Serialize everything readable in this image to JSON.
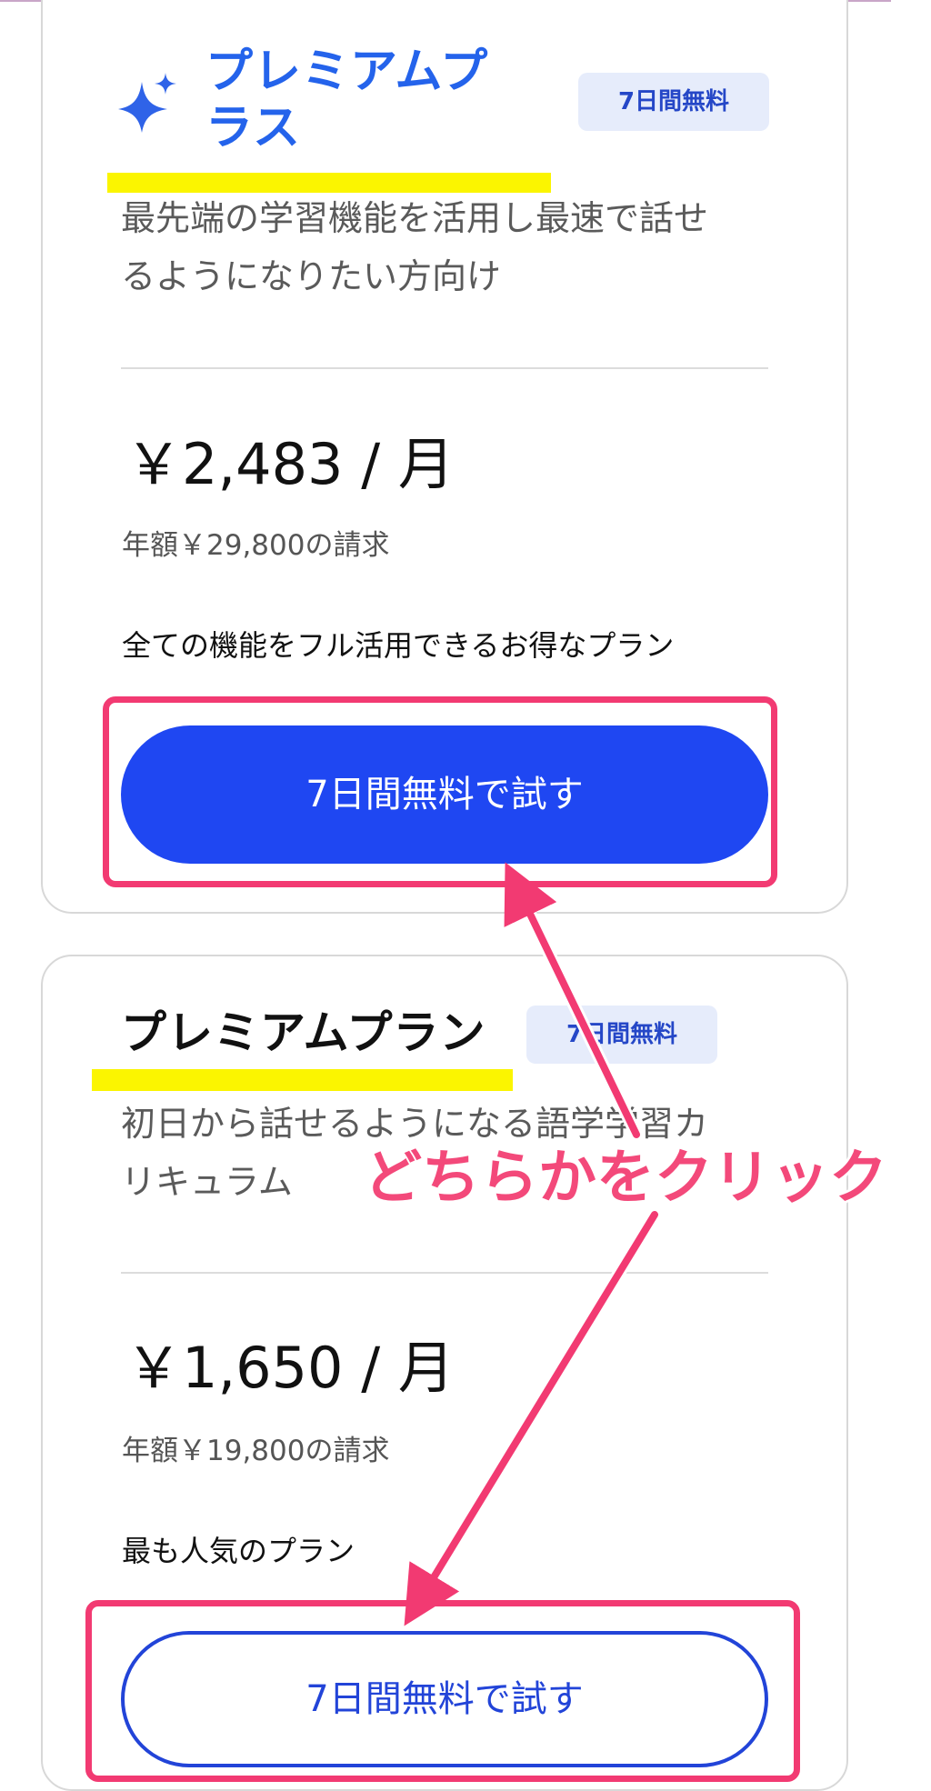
{
  "plans": [
    {
      "title_line1": "プレミアムプ",
      "title_line2": "ラス",
      "badge": "7日間無料",
      "description_line1": "最先端の学習機能を活用し最速で話せ",
      "description_line2": "るようになりたい方向け",
      "price": "￥2,483 / 月",
      "yearly": "年額￥29,800の請求",
      "tagline": "全ての機能をフル活用できるお得なプラン",
      "cta": "7日間無料で試す",
      "icon": "sparkle-icon",
      "title_color": "#2463eb",
      "button_color": "#1f47f2"
    },
    {
      "title": "プレミアムプラン",
      "badge": "7日間無料",
      "description_line1": "初日から話せるようになる語学学習カ",
      "description_line2": "リキュラム",
      "price": "￥1,650 / 月",
      "yearly": "年額￥19,800の請求",
      "tagline": "最も人気のプラン",
      "cta": "7日間無料で試す",
      "button_color": "#2244d8"
    }
  ],
  "annotation": {
    "text": "どちらかをクリック",
    "color": "#f3497a",
    "highlight_color": "#fbf500",
    "frame_color": "#f23a72"
  }
}
